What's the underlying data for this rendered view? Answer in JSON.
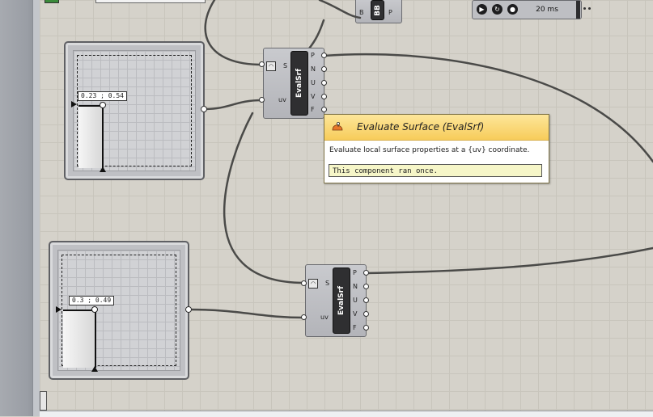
{
  "sliders": [
    {
      "readout": "0.23 ; 0.54"
    },
    {
      "readout": "0.3 ; 0.49"
    }
  ],
  "components": [
    {
      "name": "EvalSrf",
      "inputs": [
        {
          "label": "S"
        },
        {
          "label": "uv"
        }
      ],
      "outputs": [
        {
          "label": "P"
        },
        {
          "label": "N"
        },
        {
          "label": "U"
        },
        {
          "label": "V"
        },
        {
          "label": "F"
        }
      ]
    },
    {
      "name": "EvalSrf",
      "inputs": [
        {
          "label": "S"
        },
        {
          "label": "uv"
        }
      ],
      "outputs": [
        {
          "label": "P"
        },
        {
          "label": "N"
        },
        {
          "label": "U"
        },
        {
          "label": "V"
        },
        {
          "label": "F"
        }
      ]
    }
  ],
  "tooltip": {
    "title": "Evaluate Surface (EvalSrf)",
    "description": "Evaluate local surface properties at a {uv} coordinate.",
    "message": "This component ran once."
  },
  "top_widgets": {
    "bb_component": {
      "name": "BB",
      "input": "B",
      "output": "P"
    },
    "timer": {
      "interval": "20 ms"
    }
  },
  "colors": {
    "canvas": "#d5d2ca",
    "wire": "#4a4a48",
    "tooltip_header": "#f7cc5a",
    "message_bg": "#f6f6c8"
  }
}
